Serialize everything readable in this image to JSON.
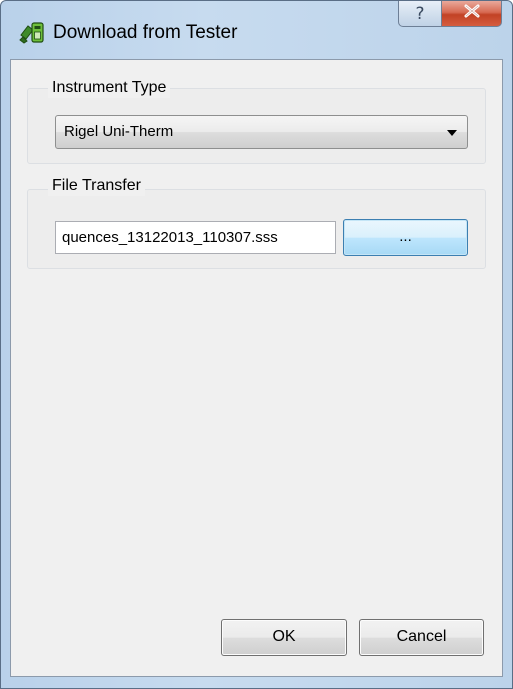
{
  "window": {
    "title": "Download from Tester",
    "icon": "tester-app-icon",
    "caption_buttons": {
      "help_glyph": "?",
      "help_icon": "help-icon",
      "close_icon": "close-icon"
    }
  },
  "instrument_group": {
    "label": "Instrument Type",
    "selected_value": "Rigel Uni-Therm"
  },
  "file_group": {
    "label": "File Transfer",
    "path_value": "quences_13122013_110307.sss",
    "browse_label": "..."
  },
  "footer": {
    "ok_label": "OK",
    "cancel_label": "Cancel"
  },
  "colors": {
    "frame": "#c7dbef",
    "close_button": "#c24225",
    "browse_focus": "#3c7fb1",
    "client_bg": "#f0f0f0"
  }
}
